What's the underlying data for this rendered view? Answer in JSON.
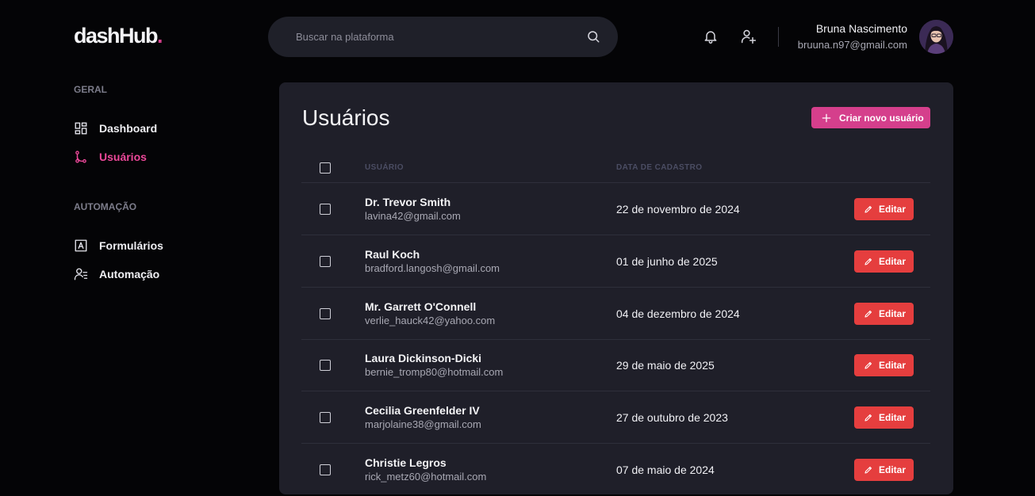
{
  "brand": {
    "name": "dashHub",
    "dot": "."
  },
  "search": {
    "placeholder": "Buscar na plataforma"
  },
  "header": {
    "user_name": "Bruna Nascimento",
    "user_email": "bruuna.n97@gmail.com"
  },
  "sidebar": {
    "sections": [
      {
        "title": "GERAL",
        "items": [
          {
            "label": "Dashboard",
            "icon": "dashboard-icon",
            "active": false
          },
          {
            "label": "Usuários",
            "icon": "git-branch-icon",
            "active": true
          }
        ]
      },
      {
        "title": "AUTOMAÇÃO",
        "items": [
          {
            "label": "Formulários",
            "icon": "form-icon",
            "active": false
          },
          {
            "label": "Automação",
            "icon": "user-automation-icon",
            "active": false
          }
        ]
      }
    ]
  },
  "main": {
    "title": "Usuários",
    "create_button": "Criar novo usuário",
    "columns": {
      "user": "USUÁRIO",
      "date": "DATA DE CADASTRO"
    },
    "edit_label": "Editar",
    "rows": [
      {
        "name": "Dr. Trevor Smith",
        "email": "lavina42@gmail.com",
        "date": "22 de novembro de 2024"
      },
      {
        "name": "Raul Koch",
        "email": "bradford.langosh@gmail.com",
        "date": "01 de junho de 2025"
      },
      {
        "name": "Mr. Garrett O'Connell",
        "email": "verlie_hauck42@yahoo.com",
        "date": "04 de dezembro de 2024"
      },
      {
        "name": "Laura Dickinson-Dicki",
        "email": "bernie_tromp80@hotmail.com",
        "date": "29 de maio de 2025"
      },
      {
        "name": "Cecilia Greenfelder IV",
        "email": "marjolaine38@gmail.com",
        "date": "27 de outubro de 2023"
      },
      {
        "name": "Christie Legros",
        "email": "rick_metz60@hotmail.com",
        "date": "07 de maio de 2024"
      }
    ]
  },
  "colors": {
    "accent": "#d53f8c",
    "danger": "#e53e3e",
    "panel": "#1f1f29",
    "background": "#040406"
  }
}
